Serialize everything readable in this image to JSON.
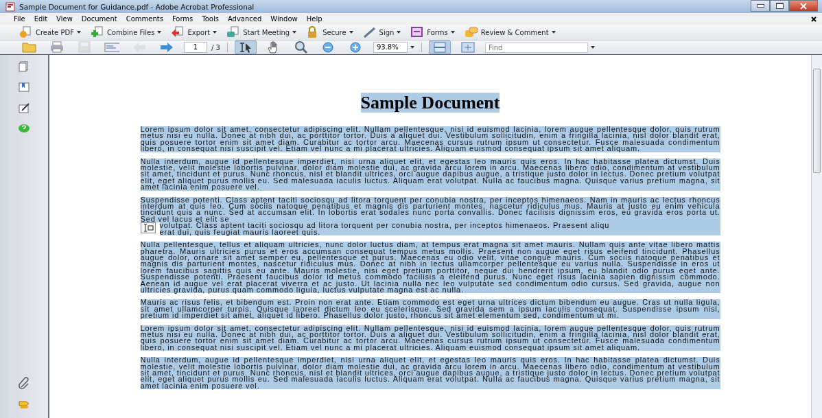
{
  "window": {
    "title": "Sample Document for Guidance.pdf - Adobe Acrobat Professional"
  },
  "menu": [
    "File",
    "Edit",
    "View",
    "Document",
    "Comments",
    "Forms",
    "Tools",
    "Advanced",
    "Window",
    "Help"
  ],
  "task_buttons": [
    {
      "kind": "create",
      "label": "Create PDF"
    },
    {
      "kind": "combine",
      "label": "Combine Files"
    },
    {
      "kind": "export",
      "label": "Export"
    },
    {
      "kind": "meeting",
      "label": "Start Meeting"
    },
    {
      "kind": "secure",
      "label": "Secure"
    },
    {
      "kind": "sign",
      "label": "Sign"
    },
    {
      "kind": "forms",
      "label": "Forms"
    },
    {
      "kind": "review",
      "label": "Review & Comment"
    }
  ],
  "tools": [
    {
      "kind": "open",
      "selected": false,
      "disabled": false
    },
    {
      "kind": "print",
      "selected": false,
      "disabled": false
    },
    {
      "kind": "save",
      "selected": false,
      "disabled": true
    },
    {
      "kind": "email",
      "selected": false,
      "disabled": false
    },
    {
      "kind": "back",
      "selected": false,
      "disabled": true
    },
    {
      "kind": "forward",
      "selected": false,
      "disabled": false
    },
    {
      "kind": "page",
      "value": "1",
      "total": "/ 3"
    },
    {
      "kind": "select",
      "selected": true,
      "disabled": false
    },
    {
      "kind": "hand",
      "selected": false,
      "disabled": false
    },
    {
      "kind": "zoomtool",
      "selected": false,
      "disabled": false
    },
    {
      "kind": "zoomout",
      "selected": false,
      "disabled": false
    },
    {
      "kind": "zoomin",
      "selected": false,
      "disabled": false
    },
    {
      "kind": "zoom",
      "value": "93.8%"
    },
    {
      "kind": "fitpage",
      "selected": true,
      "disabled": false
    },
    {
      "kind": "fullscreen",
      "selected": false,
      "disabled": false
    },
    {
      "kind": "find",
      "placeholder": "Find"
    }
  ],
  "document": {
    "title": "Sample Document",
    "paragraphs": [
      {
        "text": "Lorem ipsum dolor sit amet, consectetur adipiscing elit. Nullam pellentesque, nisi id euismod lacinia, lorem augue pellentesque dolor, quis rutrum metus nisi eu nulla. Donec at nibh dui, ac porttitor tortor. Duis a aliquet dui. Vestibulum sollicitudin, enim a fringilla lacinia, nisl dolor blandit erat, quis posuere tortor enim sit amet diam. Curabitur ac tortor arcu. Maecenas cursus rutrum ipsum ut consectetur. Fusce malesuada condimentum libero, in consequat nisi suscipit vel. Etiam vel nunc a mi placerat ultricies. Aliquam euismod consequat ipsum sit amet aliquam."
      },
      {
        "text": "Nulla interdum, augue id pellentesque imperdiet, nisi urna aliquet elit, et egestas leo mauris quis eros. In hac habitasse platea dictumst. Duis molestie, velit molestie lobortis pulvinar, dolor diam molestie dui, ac gravida arcu lorem in arcu. Maecenas libero odio, condimentum at vestibulum sit amet, tincidunt et purus. Nunc rhoncus, nisl et blandit ultrices, orci augue dapibus augue, a tristique justo dolor in lectus. Donec pretium volutpat elit, eget aliquet purus mollis eu. Sed malesuada iaculis luctus. Aliquam erat volutpat. Nulla ac faucibus magna. Quisque varius pretium magna, sit amet lacinia enim posuere vel."
      },
      {
        "segments": [
          "Suspendisse potenti. Class aptent taciti sociosqu ad litora torquent per conubia nostra, per inceptos himenaeos. Nam in mauris ac lectus rhoncus interdum at quis leo. Cum sociis natoque penatibus et magnis dis parturient montes, nascetur ridiculus mus. Mauris at justo eu enim vehicula tincidunt quis a nunc. Sed at accumsan elit. In lobortis erat sodales nunc porta convallis. Donec facilisis dignissim eros, eu gravida eros porta ut. Sed vel lacus et elit se",
          "volutpat. Class aptent taciti sociosqu ad litora torquent per conubia nostra, per inceptos himenaeos. Praesent aliqu",
          "erat dui, quis feugiat mauris laoreet quis."
        ]
      },
      {
        "text": "Nulla pellentesque, tellus et aliquam ultricies, nunc dolor luctus diam, at tempus erat magna sit amet mauris. Nullam quis ante vitae libero mattis pharetra. Mauris ultricies purus et eros accumsan consequat tempus metus mollis. Praesent non augue eget risus eleifend tincidunt. Phasellus augue dolor, ornare sit amet semper eu, pellentesque et purus. Maecenas eu odio velit, vitae congue mauris. Cum sociis natoque penatibus et magnis dis parturient montes, nascetur ridiculus mus. Donec at nibh in lectus ullamcorper pellentesque eu varius nulla. Suspendisse in eros ut lorem faucibus sagittis quis eu ante. Mauris molestie, nisi eget pretium porttitor, neque dui hendrerit ipsum, eu blandit odio purus eget ante. Suspendisse potenti. Praesent faucibus dolor id metus commodo facilisis a eleifend purus. Nunc eget risus lacinia sapien dignissim commodo. Aenean id augue vel erat placerat viverra et ac justo. Ut lacinia nulla nec leo vulputate sed condimentum odio cursus. Sed gravida, augue non ultricies gravida, purus quam commodo ligula, luctus vulputate magna est ac nulla."
      },
      {
        "text": "Mauris ac risus felis, et bibendum est. Proin non erat ante. Etiam commodo est eget urna ultrices dictum bibendum eu augue. Cras ut nulla ligula, sit amet ullamcorper turpis. Quisque laoreet dictum leo eu scelerisque. Sed gravida sem a ipsum iaculis consequat. Suspendisse ipsum nisl, pretium id imperdiet sit amet, aliquet id libero. Phasellus dolor justo, rhoncus sit amet elementum sed, condimentum ut mi."
      },
      {
        "text": "Lorem ipsum dolor sit amet, consectetur adipiscing elit. Nullam pellentesque, nisi id euismod lacinia, lorem augue pellentesque dolor, quis rutrum metus nisi eu nulla. Donec at nibh dui, ac porttitor tortor. Duis a aliquet dui. Vestibulum sollicitudin, enim a fringilla lacinia, nisl dolor blandit erat, quis posuere tortor enim sit amet diam. Curabitur ac tortor arcu. Maecenas cursus rutrum ipsum ut consectetur. Fusce malesuada condimentum libero, in consequat nisi suscipit vel. Etiam vel nunc a mi placerat ultricies. Aliquam euismod consequat ipsum sit amet aliquam."
      },
      {
        "text": "Nulla interdum, augue id pellentesque imperdiet, nisi urna aliquet elit, et egestas leo mauris quis eros. In hac habitasse platea dictumst. Duis molestie, velit molestie lobortis pulvinar, dolor diam molestie dui, ac gravida arcu lorem in arcu. Maecenas libero odio, condimentum at vestibulum sit amet, tincidunt et purus. Nunc rhoncus, nisl et blandit ultrices, orci augue dapibus augue, a tristique justo dolor in lectus. Donec pretium volutpat elit, eget aliquet purus mollis eu. Sed malesuada iaculis luctus. Aliquam erat volutpat. Nulla ac faucibus magna. Quisque varius pretium magna, sit amet lacinia enim posuere vel."
      }
    ]
  },
  "nav_panel": [
    {
      "kind": "pages"
    },
    {
      "kind": "bookmarks"
    },
    {
      "kind": "signatures"
    },
    {
      "kind": "help"
    },
    {
      "kind": "attachments"
    },
    {
      "kind": "tags"
    }
  ]
}
